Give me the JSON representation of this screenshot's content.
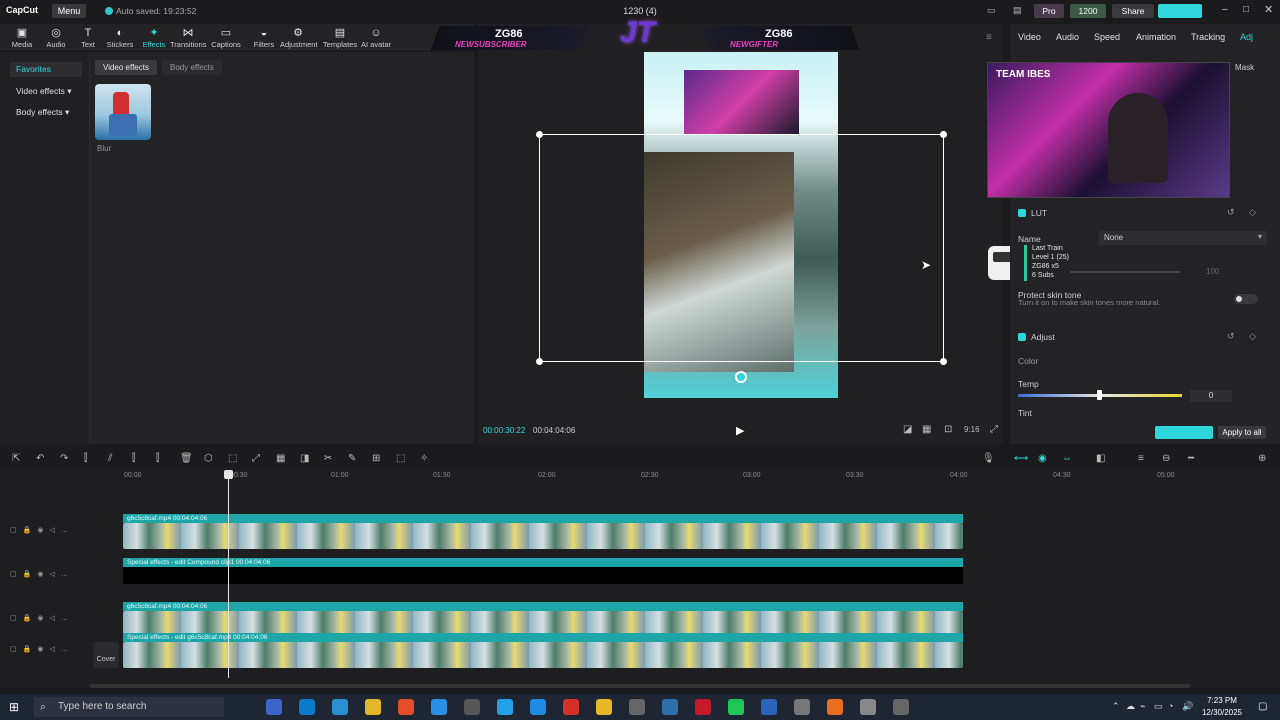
{
  "titlebar": {
    "logo": "CapCut",
    "menu": "Menu",
    "autosave": "Auto saved: 19:23:52",
    "project": "1230 (4)",
    "pro": "Pro",
    "credits": "1200",
    "share": "Share"
  },
  "toolbar": {
    "items": [
      "Media",
      "Audio",
      "Text",
      "Stickers",
      "Effects",
      "Transitions",
      "Captions",
      "Filters",
      "Adjustment",
      "Templates",
      "AI avatar"
    ]
  },
  "overlay": {
    "left_name": "ZG86",
    "left_tag": "NEWSUBSCRIBER",
    "logo": "JT",
    "right_name": "ZG86",
    "right_tag": "NEWGIFTER"
  },
  "sidebar": {
    "favorites": "Favorites",
    "video_effects": "Video effects",
    "body_effects": "Body effects"
  },
  "effects": {
    "chip_video": "Video effects",
    "chip_body": "Body effects",
    "item": "Blur"
  },
  "player": {
    "current": "00:00:30:22",
    "total": "00:04:04:06"
  },
  "right_tabs": [
    "Video",
    "Audio",
    "Speed",
    "Animation",
    "Tracking",
    "Adj"
  ],
  "right": {
    "mask": "Mask",
    "cam_text": "TEAM IBES",
    "lut": "LUT",
    "name_label": "Name",
    "name_value": "None",
    "goals": [
      "Last Train",
      "Level 1 (25)",
      "ZG86 x5",
      "6 Subs"
    ],
    "intensity": "100",
    "protect": "Protect skin tone",
    "protect_desc": "Turn it on to make skin tones more natural.",
    "adjust": "Adjust",
    "color": "Color",
    "temp": "Temp",
    "temp_value": "0",
    "tint": "Tint",
    "apply_all": "Apply to all"
  },
  "timeline": {
    "ruler": [
      "00:00",
      "00:30",
      "01:00",
      "01:30",
      "02:00",
      "02:30",
      "03:00",
      "03:30",
      "04:00",
      "04:30",
      "05:00"
    ],
    "tracks": [
      {
        "label": "g6c5c8caf.mp4   00:04:04:06"
      },
      {
        "label": "Special effects - edit   Compound clip1   00:04:04:06"
      },
      {
        "label": "g6c5c8caf.mp4   00:04:04:06"
      },
      {
        "label": "Special effects - edit   g6c5c8caf.mp4   00:04:04:06"
      }
    ],
    "cover": "Cover"
  },
  "taskbar": {
    "search": "Type here to search",
    "time": "7:23 PM",
    "date": "12/30/2025"
  }
}
